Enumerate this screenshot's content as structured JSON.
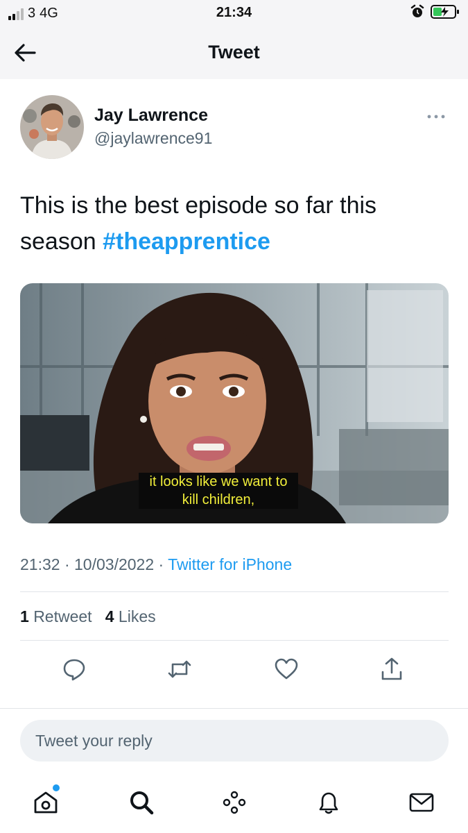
{
  "status_bar": {
    "carrier": "3",
    "network": "4G",
    "time": "21:34"
  },
  "header": {
    "title": "Tweet"
  },
  "tweet": {
    "author_name": "Jay Lawrence",
    "author_handle": "@jaylawrence91",
    "text": "This is the best episode so far this season",
    "hashtag": "#theapprentice",
    "media_caption": "it looks like we want to kill children,",
    "time": "21:32",
    "date": "10/03/2022",
    "source": "Twitter for iPhone",
    "retweets_count": "1",
    "retweets_label": "Retweet",
    "likes_count": "4",
    "likes_label": "Likes"
  },
  "reply": {
    "placeholder": "Tweet your reply"
  },
  "icons": {
    "back": "arrow-left-icon",
    "more": "more-horizontal-icon",
    "reply": "comment-icon",
    "retweet": "retweet-icon",
    "like": "heart-icon",
    "share": "share-icon",
    "home": "home-icon",
    "search": "search-icon",
    "spaces": "spaces-icon",
    "notifications": "bell-icon",
    "messages": "mail-icon"
  },
  "colors": {
    "accent": "#1d9bf0",
    "text": "#0f1419",
    "secondary": "#536471",
    "subtitle": "#f2ef3a"
  }
}
